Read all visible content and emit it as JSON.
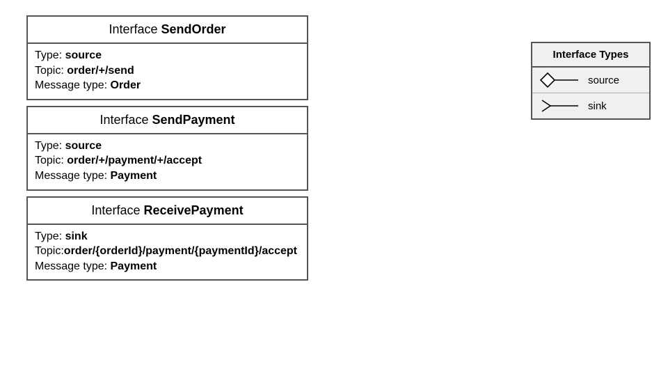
{
  "header_prefix": "Interface",
  "labels": {
    "type": "Type: ",
    "topic": "Topic: ",
    "topic_tight": "Topic:",
    "message_type": "Message type: "
  },
  "interfaces": [
    {
      "name": "SendOrder",
      "type": "source",
      "topic": "order/+/send",
      "message_type": "Order"
    },
    {
      "name": "SendPayment",
      "type": "source",
      "topic": "order/+/payment/+/accept",
      "message_type": "Payment"
    },
    {
      "name": "ReceivePayment",
      "type": "sink",
      "topic": "order/{orderId}/payment/{paymentId}/accept",
      "message_type": "Payment"
    }
  ],
  "legend": {
    "title": "Interface Types",
    "items": [
      {
        "label": "source",
        "icon": "source"
      },
      {
        "label": "sink",
        "icon": "sink"
      }
    ]
  }
}
